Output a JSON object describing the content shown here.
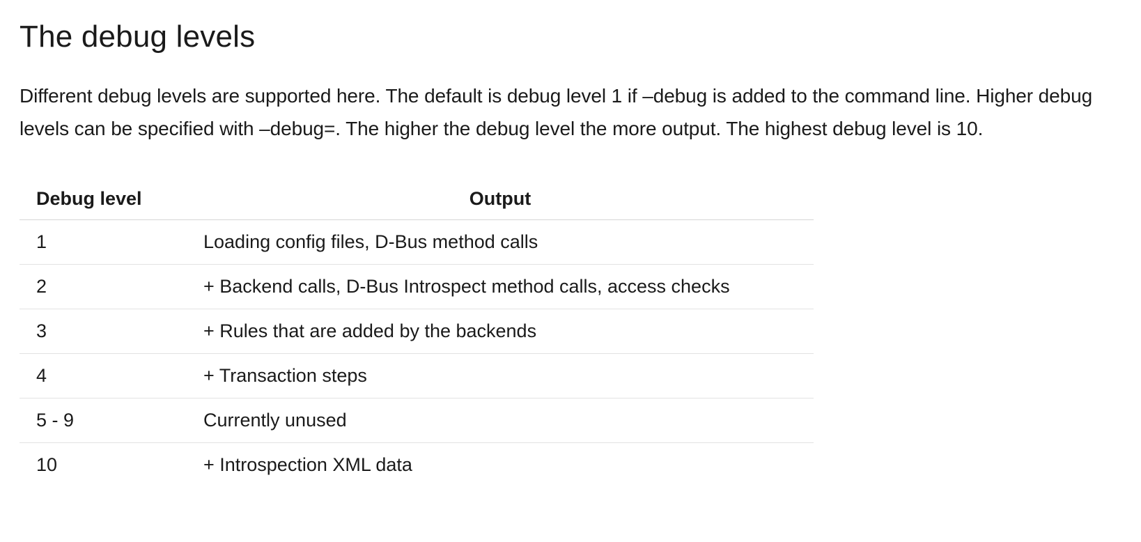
{
  "heading": "The debug levels",
  "intro": "Different debug levels are supported here. The default is debug level 1 if –debug is added to the command line. Higher debug levels can be specified with –debug=. The higher the debug level the more output. The highest debug level is 10.",
  "table": {
    "headers": {
      "level": "Debug level",
      "output": "Output"
    },
    "rows": [
      {
        "level": "1",
        "output": "Loading config files, D-Bus method calls"
      },
      {
        "level": "2",
        "output": "+ Backend calls, D-Bus Introspect method calls, access checks"
      },
      {
        "level": "3",
        "output": "+ Rules that are added by the backends"
      },
      {
        "level": "4",
        "output": "+ Transaction steps"
      },
      {
        "level": "5 - 9",
        "output": "Currently unused"
      },
      {
        "level": "10",
        "output": "+ Introspection XML data"
      }
    ]
  }
}
